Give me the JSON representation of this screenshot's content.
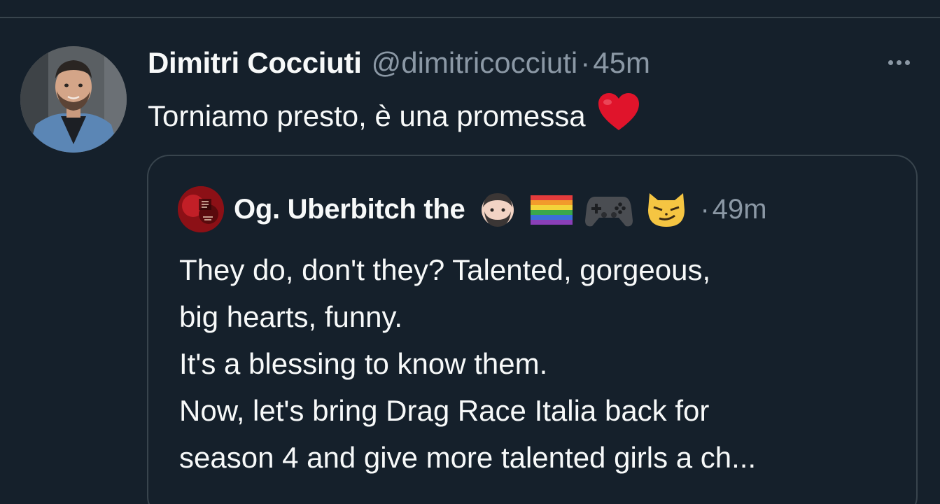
{
  "tweet": {
    "author": {
      "display_name": "Dimitri Cocciuti",
      "handle": "@dimitricocciuti"
    },
    "separator": "·",
    "time": "45m",
    "text": "Torniamo presto, è una promessa",
    "text_emoji": "red-heart",
    "more_icon": "ellipsis-icon"
  },
  "quoted_tweet": {
    "author": {
      "display_name": "Og. Uberbitch the",
      "name_emojis": [
        "man-beard-emoji",
        "rainbow-flag-emoji",
        "game-controller-emoji",
        "smirking-cat-emoji"
      ]
    },
    "separator": "·",
    "time": "49m",
    "lines": [
      "They do, don't they? Talented, gorgeous,",
      "big hearts, funny.",
      "It's a blessing to know them.",
      "Now, let's bring Drag Race Italia back for",
      "season 4 and give more talented girls a ch..."
    ]
  },
  "colors": {
    "background": "#15202b",
    "border": "#38444d",
    "text_primary": "#f7f9f9",
    "text_secondary": "#8b98a5",
    "heart": "#e0142b"
  }
}
